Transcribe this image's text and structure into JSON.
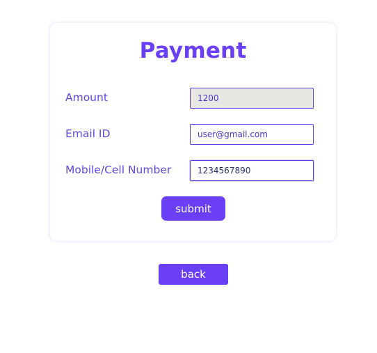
{
  "payment_form": {
    "title": "Payment",
    "fields": [
      {
        "label": "Amount",
        "value": "1200",
        "readonly": true
      },
      {
        "label": "Email ID",
        "value": "user@gmail.com",
        "readonly": false
      },
      {
        "label": "Mobile/Cell Number",
        "value": "1234567890",
        "readonly": false,
        "focused": true
      }
    ],
    "submit_label": "submit"
  },
  "back_label": "back",
  "colors": {
    "accent": "#6a3ff5",
    "label_text": "#6046e8",
    "readonly_bg": "#e9e7e3",
    "button_text": "#ffffff"
  }
}
